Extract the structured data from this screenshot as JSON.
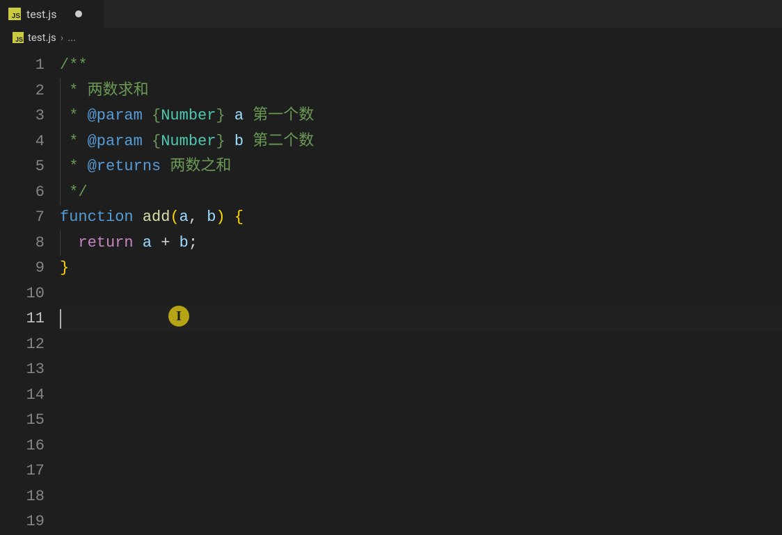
{
  "tab": {
    "icon": "JS",
    "label": "test.js",
    "dirty": true
  },
  "breadcrumb": {
    "icon": "JS",
    "file": "test.js",
    "chevron": "›",
    "ellipsis": "..."
  },
  "gutter": {
    "start": 1,
    "end": 19,
    "current": 11
  },
  "code": {
    "line1": {
      "open": "/**"
    },
    "line2": {
      "star": " * ",
      "text": "两数求和"
    },
    "line3": {
      "star": " * ",
      "tag": "@param",
      "braceL": " {",
      "type": "Number",
      "braceR": "} ",
      "var": "a",
      "desc": " 第一个数"
    },
    "line4": {
      "star": " * ",
      "tag": "@param",
      "braceL": " {",
      "type": "Number",
      "braceR": "} ",
      "var": "b",
      "desc": " 第二个数"
    },
    "line5": {
      "star": " * ",
      "tag": "@returns",
      "desc": " 两数之和"
    },
    "line6": {
      "close": " */"
    },
    "line7": {
      "kw": "function",
      "sp": " ",
      "fn": "add",
      "paren": "(",
      "a": "a",
      "comma": ", ",
      "b": "b",
      "parenR": ")",
      "sp2": " ",
      "braceL": "{"
    },
    "line8": {
      "indent": "  ",
      "kw": "return",
      "sp": " ",
      "a": "a",
      "op": " + ",
      "b": "b",
      "semi": ";"
    },
    "line9": {
      "braceR": "}"
    }
  },
  "caretCursor": "I"
}
